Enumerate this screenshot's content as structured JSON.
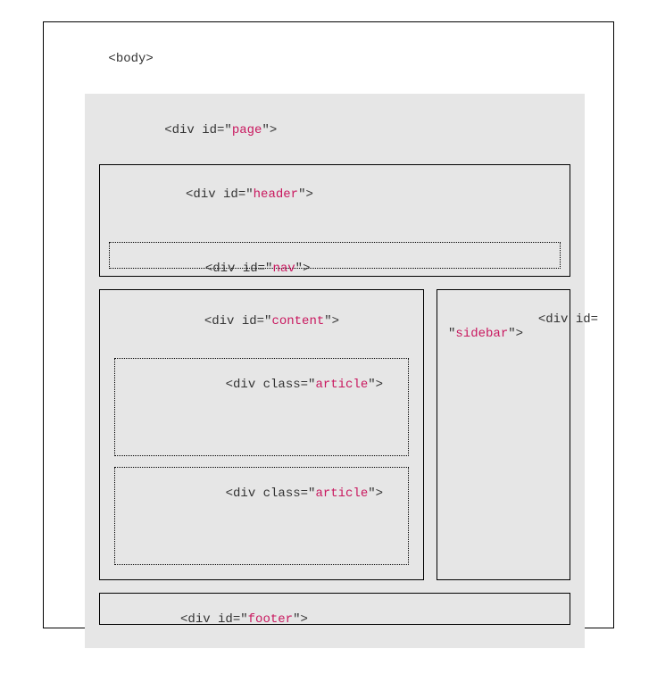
{
  "diagram": {
    "body": {
      "open": "<body>"
    },
    "page": {
      "tag": "<div id=\"",
      "val": "page",
      "end": "\">"
    },
    "header": {
      "tag": "<div id=\"",
      "val": "header",
      "end": "\">"
    },
    "nav": {
      "tag": "<div id=\"",
      "val": "nav",
      "end": "\">"
    },
    "content": {
      "tag": "<div id=\"",
      "val": "content",
      "end": "\">"
    },
    "article": {
      "tag": "<div class=\"",
      "val": "article",
      "end": "\">"
    },
    "sidebar": {
      "line1": "<div id=",
      "line2a": "\"",
      "line2b": "sidebar",
      "line2c": "\">"
    },
    "footer": {
      "tag": "<div id=\"",
      "val": "footer",
      "end": "\">"
    }
  }
}
